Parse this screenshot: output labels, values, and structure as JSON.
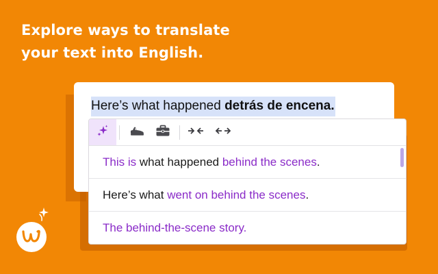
{
  "headline": {
    "line1": "Explore ways to translate",
    "line2": "your text into English."
  },
  "editor": {
    "source_plain": "Here’s what happened ",
    "source_bold": "detrás de encena."
  },
  "toolbar": {
    "buttons": [
      {
        "icon": "sparkles-icon",
        "active": true
      },
      {
        "icon": "sneaker-icon",
        "active": false
      },
      {
        "icon": "briefcase-icon",
        "active": false
      },
      {
        "icon": "shorten-icon",
        "active": false
      },
      {
        "icon": "expand-icon",
        "active": false
      }
    ]
  },
  "suggestions": [
    {
      "segments": [
        {
          "text": "This is",
          "highlight": true
        },
        {
          "text": " what happened ",
          "highlight": false
        },
        {
          "text": "behind the scenes",
          "highlight": true
        },
        {
          "text": ".",
          "highlight": false
        }
      ]
    },
    {
      "segments": [
        {
          "text": "Here’s what ",
          "highlight": false
        },
        {
          "text": "went on behind the scenes",
          "highlight": true
        },
        {
          "text": ".",
          "highlight": false
        }
      ]
    },
    {
      "segments": [
        {
          "text": "The behind-the-scene story.",
          "highlight": true
        }
      ]
    }
  ],
  "colors": {
    "background": "#f28705",
    "highlight_text": "#8a2bc8",
    "selection": "#d7e2f9",
    "active_tool": "#f0e3fb"
  }
}
